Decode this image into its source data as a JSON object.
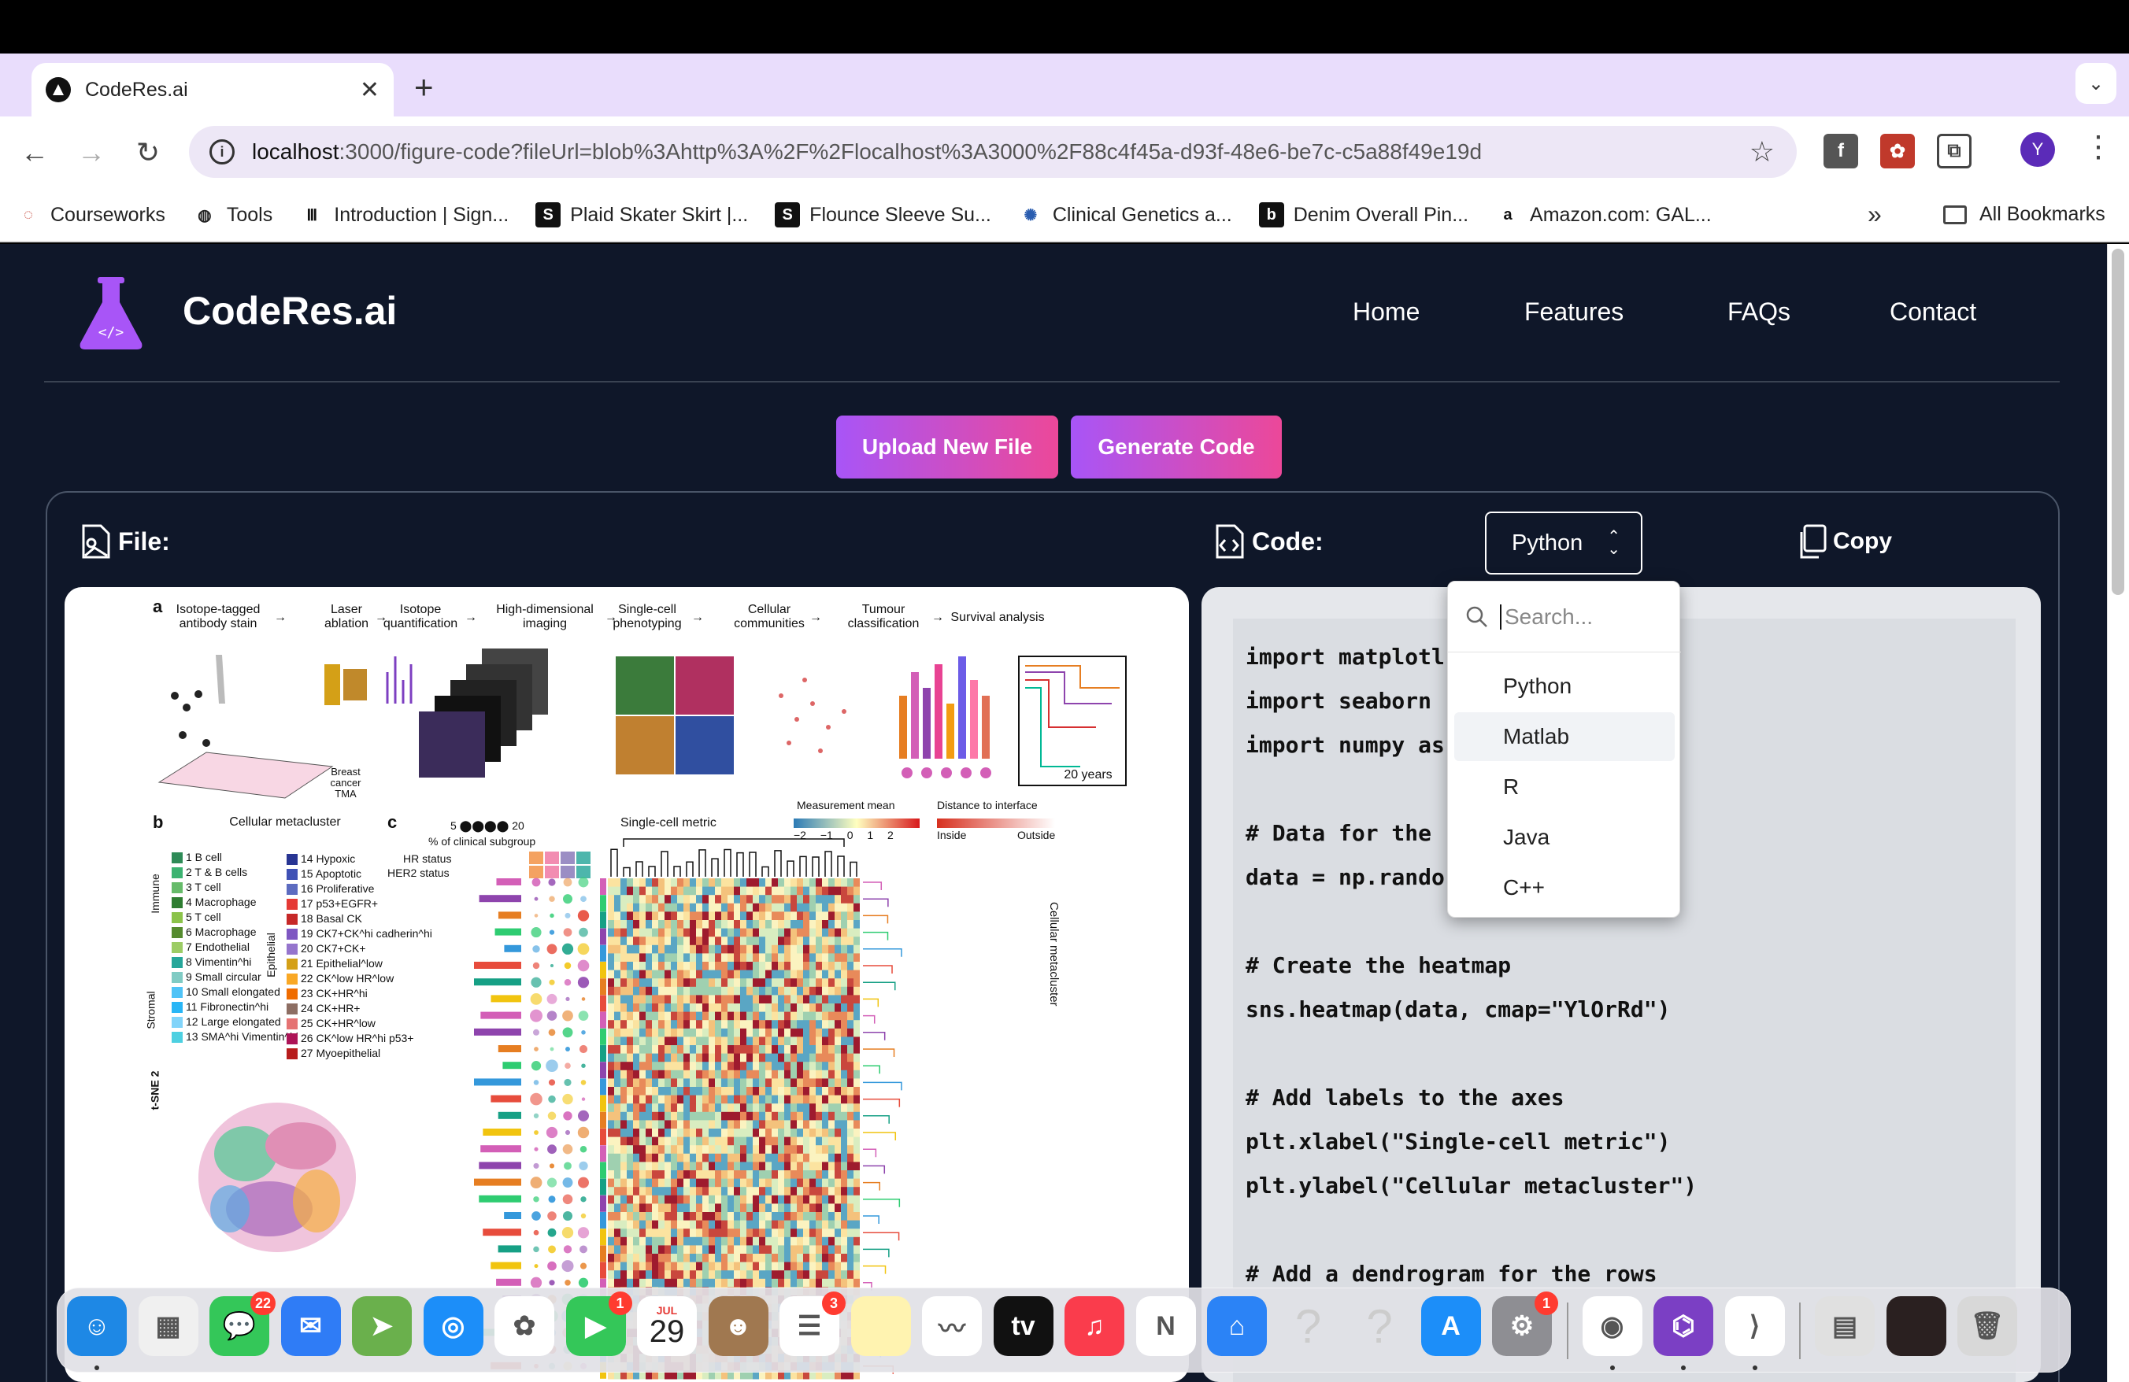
{
  "browser": {
    "tab_title": "CodeRes.ai",
    "url_host": "localhost",
    "url_rest": ":3000/figure-code?fileUrl=blob%3Ahttp%3A%2F%2Flocalhost%3A3000%2F88c4f45a-d93f-48e6-be7c-c5a88f49e19d",
    "avatar_letter": "Y",
    "bookmarks": [
      {
        "label": "Courseworks",
        "icon": "courseworks-icon"
      },
      {
        "label": "Tools",
        "icon": "tools-icon"
      },
      {
        "label": "Introduction | Sign...",
        "icon": "intro-icon"
      },
      {
        "label": "Plaid Skater Skirt |...",
        "icon": "s-icon"
      },
      {
        "label": "Flounce Sleeve Su...",
        "icon": "s-icon"
      },
      {
        "label": "Clinical Genetics a...",
        "icon": "genetics-icon"
      },
      {
        "label": "Denim Overall Pin...",
        "icon": "b-icon"
      },
      {
        "label": "Amazon.com: GAL...",
        "icon": "amazon-icon"
      }
    ],
    "all_bookmarks": "All Bookmarks"
  },
  "site": {
    "brand": "CodeRes.ai",
    "nav": [
      "Home",
      "Features",
      "FAQs",
      "Contact"
    ],
    "upload_button": "Upload New File",
    "generate_button": "Generate Code",
    "file_label": "File:",
    "code_label": "Code:",
    "language_selected": "Python",
    "copy_label": "Copy",
    "accent_start": "#a855f7",
    "accent_end": "#ec4899"
  },
  "dropdown": {
    "placeholder": "Search...",
    "options": [
      "Python",
      "Matlab",
      "R",
      "Java",
      "C++"
    ],
    "highlighted": "Matlab"
  },
  "code_lines": [
    "import matplotl",
    "import seaborn ",
    "import numpy as",
    "",
    "# Data for the ",
    "data = np.rando",
    "",
    "# Create the heatmap",
    "sns.heatmap(data, cmap=\"YlOrRd\")",
    "",
    "# Add labels to the axes",
    "plt.xlabel(\"Single-cell metric\")",
    "plt.ylabel(\"Cellular metacluster\")",
    "",
    "# Add a dendrogram for the rows"
  ],
  "figure": {
    "panel_a_steps": [
      "Isotope-tagged\nantibody stain",
      "Laser\nablation",
      "Isotope\nquantification",
      "High-dimensional\nimaging",
      "Single-cell\nphenotyping",
      "Cellular\ncommunities",
      "Tumour\nclassification",
      "Survival analysis"
    ],
    "breast_label": "Breast\ncancer\nTMA",
    "years_label": "20 years",
    "panel_b_title": "Cellular metacluster",
    "clusters_left": [
      "1 B cell",
      "2 T & B cells",
      "3 T cell",
      "4 Macrophage",
      "5 T cell",
      "6 Macrophage",
      "7 Endothelial",
      "8 Vimentin^hi",
      "9 Small circular",
      "10 Small elongated",
      "11 Fibronectin^hi",
      "12 Large elongated",
      "13 SMA^hi Vimentin^hi"
    ],
    "clusters_right": [
      "14 Hypoxic",
      "15 Apoptotic",
      "16 Proliferative",
      "17 p53+EGFR+",
      "18 Basal CK",
      "19 CK7+CK^hi cadherin^hi",
      "20 CK7+CK+",
      "21 Epithelial^low",
      "22 CK^low HR^low",
      "23 CK+HR^hi",
      "24 CK+HR+",
      "25 CK+HR^low",
      "26 CK^low HR^hi p53+",
      "27 Myoepithelial"
    ],
    "group_immune": "Immune",
    "group_stromal": "Stromal",
    "group_epithelial": "Epithelial",
    "tsne_label": "t-SNE 2",
    "panel_c_scale": "5 ⬤⬤⬤⬤ 20",
    "panel_c_subgroup": "% of clinical subgroup",
    "hr_status": "HR status",
    "her2_status": "HER2 status",
    "single_cell_metric": "Single-cell metric",
    "measurement_mean": "Measurement mean",
    "mm_ticks": "−2 −1 0 1 2",
    "distance_interface": "Distance to interface",
    "inside": "Inside",
    "outside": "Outside",
    "cellular_metacluster": "Cellular metacluster"
  },
  "dock": [
    {
      "name": "finder-icon",
      "color": "#1e88e5"
    },
    {
      "name": "launchpad-icon",
      "color": "#f0f0f0"
    },
    {
      "name": "messages-icon",
      "color": "#34c759",
      "badge": "22"
    },
    {
      "name": "mail-icon",
      "color": "#2f7cf6"
    },
    {
      "name": "maps-icon",
      "color": "#6ab04c"
    },
    {
      "name": "safari-icon",
      "color": "#1c8ef9"
    },
    {
      "name": "photos-icon",
      "color": "#ffffff"
    },
    {
      "name": "facetime-icon",
      "color": "#34c759",
      "badge": "1"
    },
    {
      "name": "calendar-icon",
      "color": "#ffffff",
      "month": "JUL",
      "day": "29"
    },
    {
      "name": "contacts-icon",
      "color": "#a07850"
    },
    {
      "name": "reminders-icon",
      "color": "#ffffff",
      "badge": "3"
    },
    {
      "name": "notes-icon",
      "color": "#fff3b0"
    },
    {
      "name": "freeform-icon",
      "color": "#ffffff"
    },
    {
      "name": "appletv-icon",
      "color": "#111111"
    },
    {
      "name": "music-icon",
      "color": "#fa3c4c"
    },
    {
      "name": "news-icon",
      "color": "#ffffff"
    },
    {
      "name": "keynote-icon",
      "color": "#2b83f6"
    },
    {
      "name": "unknown-app-icon",
      "color": "transparent"
    },
    {
      "name": "unknown-app-icon-2",
      "color": "transparent"
    },
    {
      "name": "appstore-icon",
      "color": "#1c8ef9"
    },
    {
      "name": "system-settings-icon",
      "color": "#8e8e93",
      "badge": "1"
    },
    {
      "name": "chrome-icon",
      "color": "#ffffff"
    },
    {
      "name": "github-desktop-icon",
      "color": "#7b3fc4"
    },
    {
      "name": "vscode-icon",
      "color": "#ffffff"
    },
    {
      "name": "preview-icon",
      "color": "#e0e0e0"
    },
    {
      "name": "recent-window-icon",
      "color": "#2a2020"
    },
    {
      "name": "trash-icon",
      "color": "#d8d8d8"
    }
  ]
}
